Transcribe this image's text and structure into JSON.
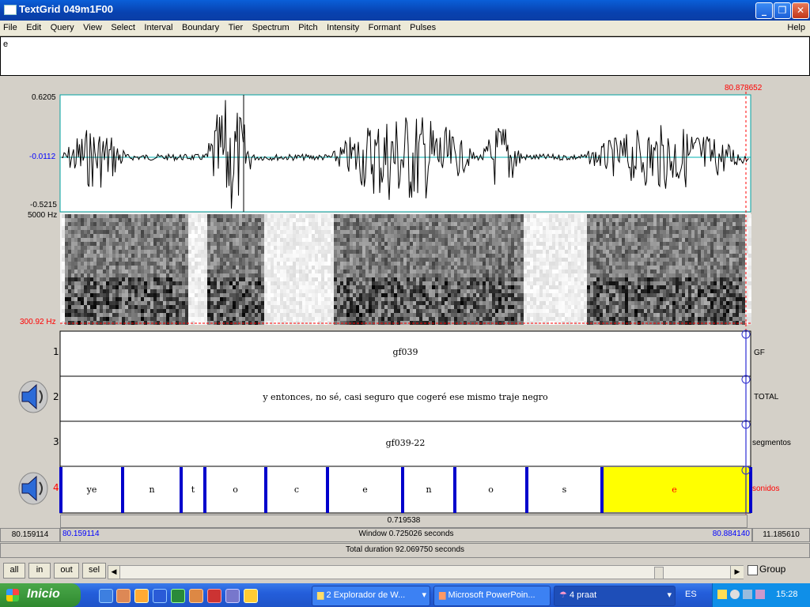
{
  "window": {
    "title": "TextGrid 049m1F00"
  },
  "menu": [
    "File",
    "Edit",
    "Query",
    "View",
    "Select",
    "Interval",
    "Boundary",
    "Tier",
    "Spectrum",
    "Pitch",
    "Intensity",
    "Formant",
    "Pulses"
  ],
  "menu_help": "Help",
  "text_field": {
    "value": "e"
  },
  "cursor_time": "80.878652",
  "waveform": {
    "max": "0.6205",
    "zero": "-0.0112",
    "min": "-0.5215"
  },
  "spectrogram": {
    "top": "5000 Hz",
    "bottom": "300.92 Hz"
  },
  "tiers": [
    {
      "num": "1",
      "name": "GF",
      "text": "gf039"
    },
    {
      "num": "2",
      "name": "TOTAL",
      "text": "y entonces, no sé, casi seguro que cogeré ese mismo traje negro"
    },
    {
      "num": "3",
      "name": "segmentos",
      "text": "gf039-22"
    },
    {
      "num": "4",
      "name": "sonidos",
      "intervals": [
        "ye",
        "n",
        "t",
        "o",
        "c",
        "e",
        "n",
        "o",
        "s",
        "e"
      ]
    }
  ],
  "durations": {
    "visible_part": "0.719538",
    "left_outside": "80.159114",
    "window_start": "80.159114",
    "window_label": "Window 0.725026 seconds",
    "window_end": "80.884140",
    "right_outside": "11.185610",
    "total": "Total duration 92.069750 seconds"
  },
  "buttons": {
    "all": "all",
    "in": "in",
    "out": "out",
    "sel": "sel"
  },
  "group_label": "Group",
  "taskbar": {
    "start": "Inicio",
    "tasks": [
      "2 Explorador de W...",
      "Microsoft PowerPoin...",
      "4 praat"
    ],
    "lang": "ES",
    "clock": "15:28"
  },
  "colors": {
    "selection": "#ffff00",
    "boundary": "#0000cc",
    "red": "#ff0000",
    "blue": "#0000ff"
  }
}
